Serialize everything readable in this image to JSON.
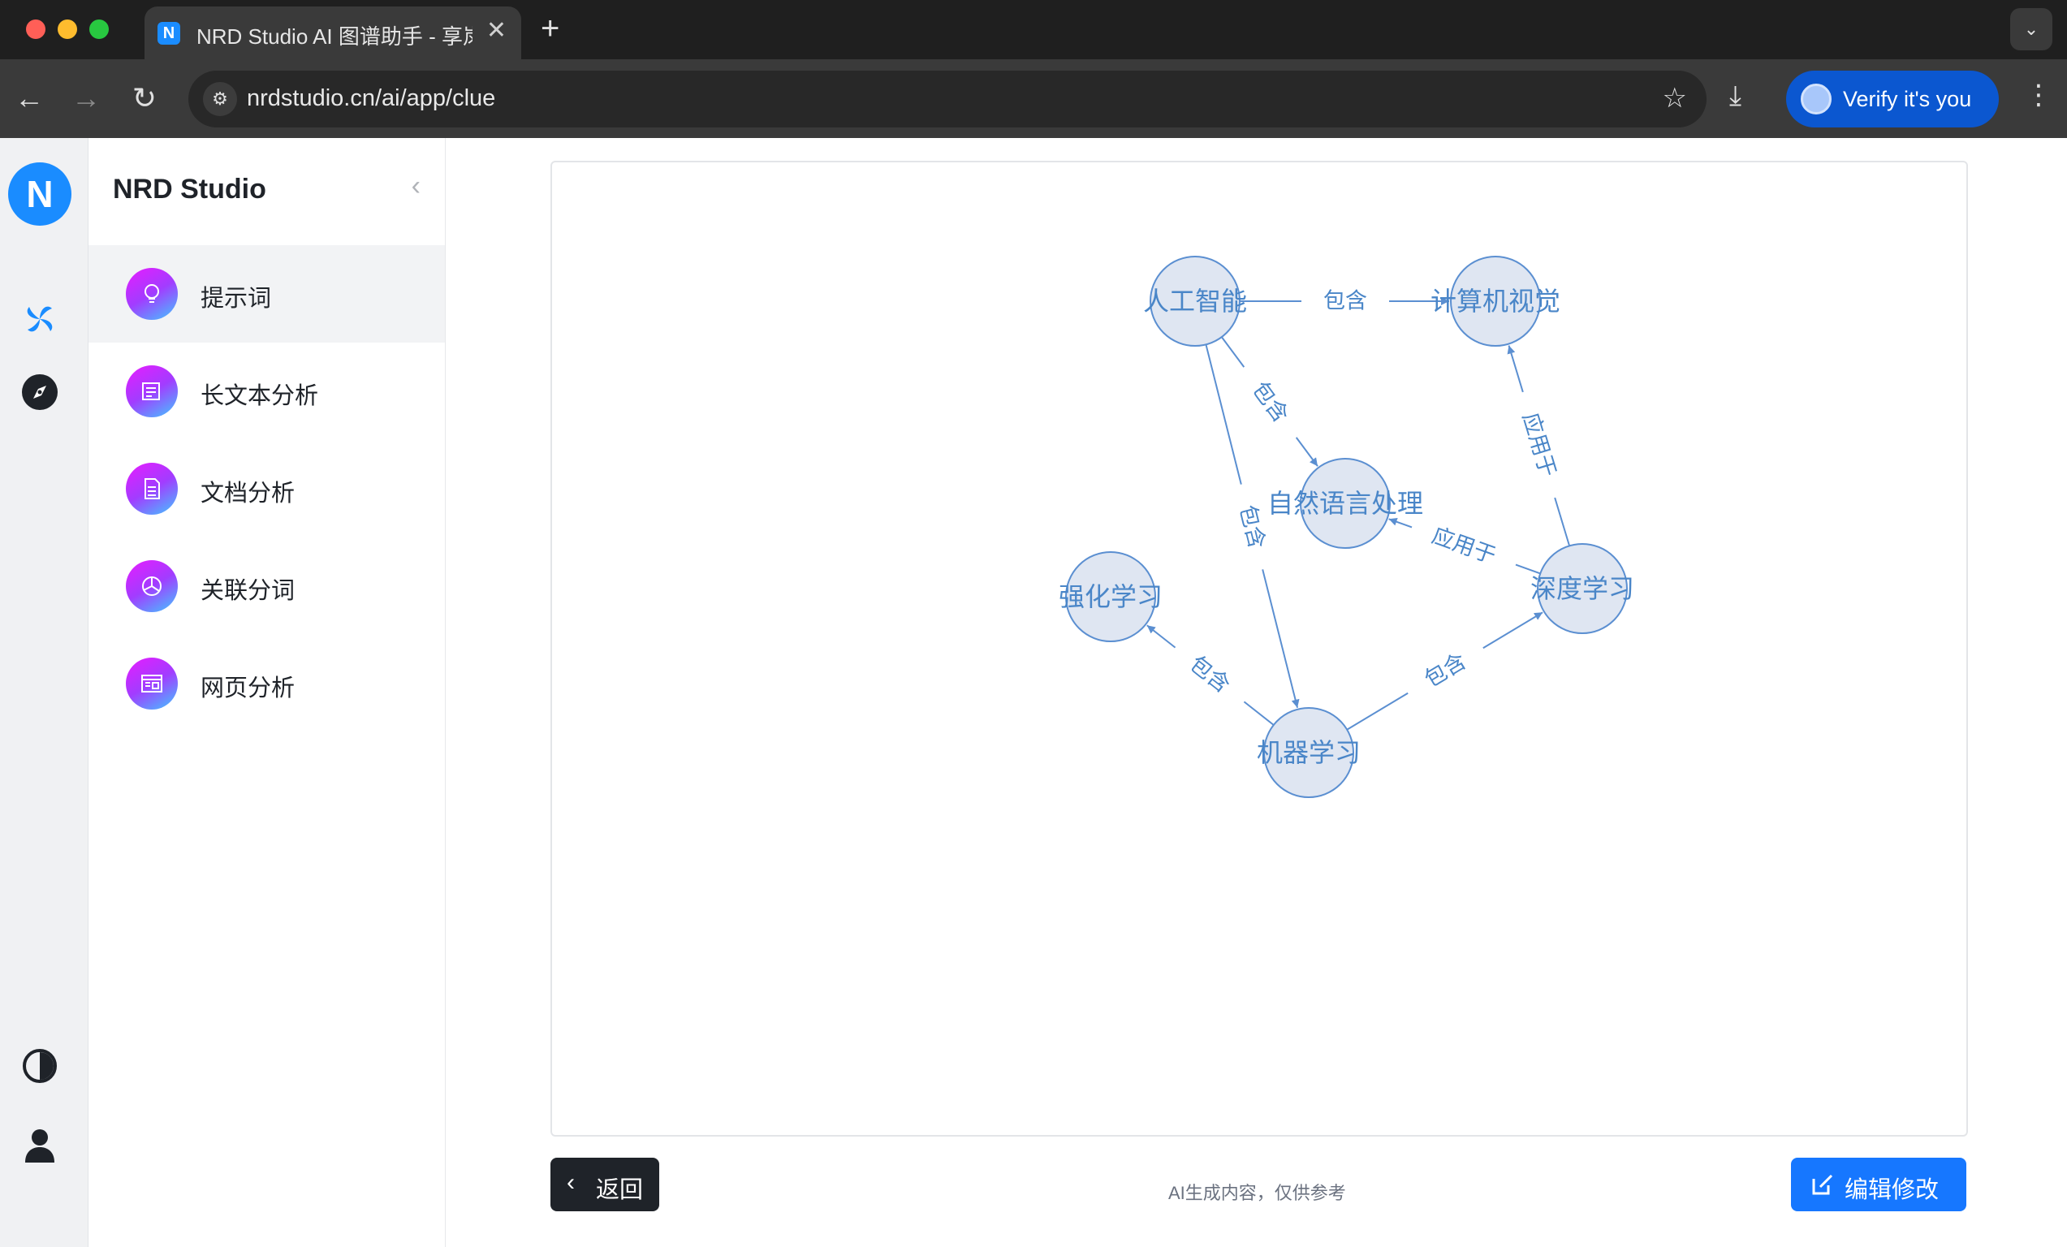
{
  "browser": {
    "tab_title": "NRD Studio AI 图谱助手 - 享岚",
    "tab_close": "✕",
    "new_tab": "+",
    "url": "nrdstudio.cn/ai/app/clue",
    "verify_label": "Verify it's you"
  },
  "sidebar": {
    "title": "NRD Studio",
    "items": [
      {
        "label": "提示词",
        "icon": "lightbulb-icon",
        "active": true
      },
      {
        "label": "长文本分析",
        "icon": "document-edit-icon",
        "active": false
      },
      {
        "label": "文档分析",
        "icon": "file-icon",
        "active": false
      },
      {
        "label": "关联分词",
        "icon": "pie-chart-icon",
        "active": false
      },
      {
        "label": "网页分析",
        "icon": "web-page-icon",
        "active": false
      }
    ]
  },
  "rail": {
    "icons": [
      "nrd-logo-icon",
      "pinwheel-icon",
      "compass-icon",
      "theme-toggle-icon",
      "user-icon"
    ]
  },
  "graph": {
    "nodes": [
      {
        "id": "ai",
        "label": "人工智能"
      },
      {
        "id": "cv",
        "label": "计算机视觉"
      },
      {
        "id": "nlp",
        "label": "自然语言处理"
      },
      {
        "id": "rl",
        "label": "强化学习"
      },
      {
        "id": "ml",
        "label": "机器学习"
      },
      {
        "id": "dl",
        "label": "深度学习"
      }
    ],
    "edges": [
      {
        "from": "ai",
        "to": "cv",
        "label": "包含"
      },
      {
        "from": "ai",
        "to": "nlp",
        "label": "包含"
      },
      {
        "from": "ai",
        "to": "ml",
        "label": "包含"
      },
      {
        "from": "dl",
        "to": "cv",
        "label": "应用于"
      },
      {
        "from": "dl",
        "to": "nlp",
        "label": "应用于"
      },
      {
        "from": "ml",
        "to": "rl",
        "label": "包含"
      },
      {
        "from": "ml",
        "to": "dl",
        "label": "包含"
      }
    ],
    "colors": {
      "node_fill": "#dfe6f2",
      "node_stroke": "#5b8fd1",
      "edge": "#5b8fd1",
      "text": "#4a86c8"
    }
  },
  "footer": {
    "back_label": "返回",
    "disclaimer": "AI生成内容，仅供参考",
    "edit_label": "编辑修改"
  }
}
